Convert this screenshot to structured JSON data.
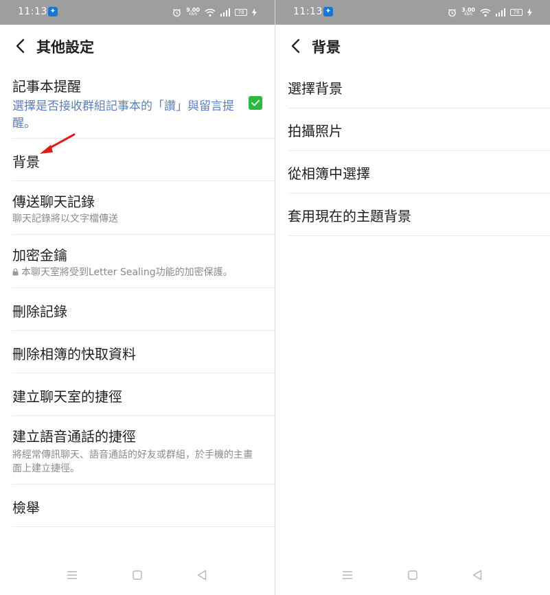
{
  "status_bar": {
    "time": "11:13",
    "left_speed_value": "9.00",
    "right_speed_value": "3.00",
    "speed_unit": "KB/S",
    "battery": "78"
  },
  "left_screen": {
    "title": "其他設定",
    "items": [
      {
        "title": "記事本提醒",
        "subtitle": "選擇是否接收群組記事本的「讚」與留言提醒。"
      },
      {
        "title": "背景"
      },
      {
        "title": "傳送聊天記錄",
        "subtitle": "聊天記錄將以文字檔傳送"
      },
      {
        "title": "加密金鑰",
        "subtitle": "本聊天室將受到Letter Sealing功能的加密保護。"
      },
      {
        "title": "刪除記錄"
      },
      {
        "title": "刪除相簿的快取資料"
      },
      {
        "title": "建立聊天室的捷徑"
      },
      {
        "title": "建立語音通話的捷徑",
        "subtitle": "將經常傳訊聊天、語音通話的好友或群組，於手機的主畫面上建立捷徑。"
      },
      {
        "title": "檢舉"
      }
    ]
  },
  "right_screen": {
    "title": "背景",
    "items": [
      {
        "title": "選擇背景"
      },
      {
        "title": "拍攝照片"
      },
      {
        "title": "從相簿中選擇"
      },
      {
        "title": "套用現在的主題背景"
      }
    ]
  },
  "colors": {
    "status_bar": "#9e9e9e",
    "accent_green": "#2bba3f",
    "link_blue": "#5a7ebf",
    "arrow_red": "#e01b1b"
  }
}
